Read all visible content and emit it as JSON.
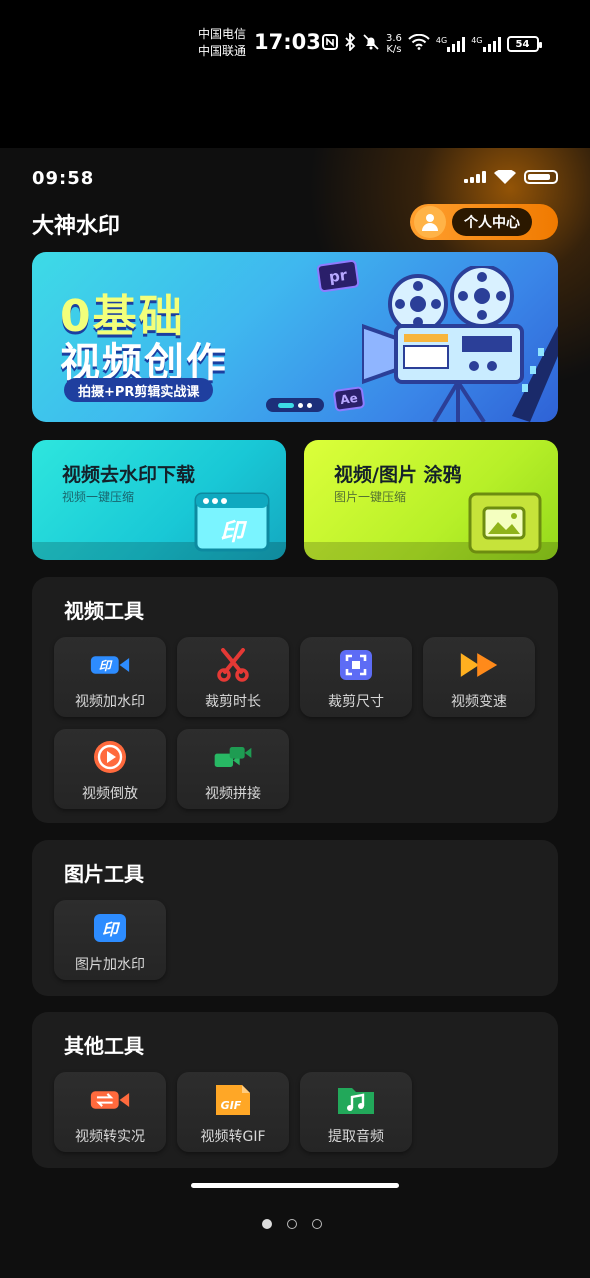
{
  "outer_status": {
    "carrier1": "中国电信",
    "carrier2": "中国联通",
    "time": "17:03",
    "speed_value": "3.6",
    "speed_unit": "K/s",
    "net1": "4G",
    "net2": "4G",
    "battery": "54"
  },
  "inner_status": {
    "time": "09:58"
  },
  "header": {
    "title": "大神水印",
    "personal_center": "个人中心"
  },
  "banner": {
    "line1": "0基础",
    "line2": "视频创作",
    "course": "拍摄+PR剪辑实战课",
    "badge_pr": "pr",
    "badge_ae": "Ae"
  },
  "features": [
    {
      "title": "视频去水印下载",
      "subtitle": "视频一键压缩",
      "icon": "watermark-window-icon",
      "icon_text": "印"
    },
    {
      "title": "视频/图片 涂鸦",
      "subtitle": "图片一键压缩",
      "icon": "image-frame-icon"
    }
  ],
  "sections": {
    "video": {
      "title": "视频工具",
      "tools": [
        {
          "label": "视频加水印",
          "icon": "video-watermark-icon"
        },
        {
          "label": "裁剪时长",
          "icon": "scissors-icon"
        },
        {
          "label": "裁剪尺寸",
          "icon": "crop-frame-icon"
        },
        {
          "label": "视频变速",
          "icon": "fast-forward-icon"
        },
        {
          "label": "视频倒放",
          "icon": "reverse-play-icon"
        },
        {
          "label": "视频拼接",
          "icon": "video-merge-icon"
        }
      ]
    },
    "image": {
      "title": "图片工具",
      "tools": [
        {
          "label": "图片加水印",
          "icon": "image-watermark-icon"
        }
      ]
    },
    "other": {
      "title": "其他工具",
      "tools": [
        {
          "label": "视频转实况",
          "icon": "video-convert-icon"
        },
        {
          "label": "视频转GIF",
          "icon": "gif-file-icon",
          "icon_text": "GIF"
        },
        {
          "label": "提取音频",
          "icon": "music-folder-icon"
        }
      ]
    }
  },
  "watermark_glyph": "印",
  "colors": {
    "accent_orange": "#f7921e",
    "card_bg": "#1d1d1d",
    "tool_bg": "#2a2a2a"
  }
}
